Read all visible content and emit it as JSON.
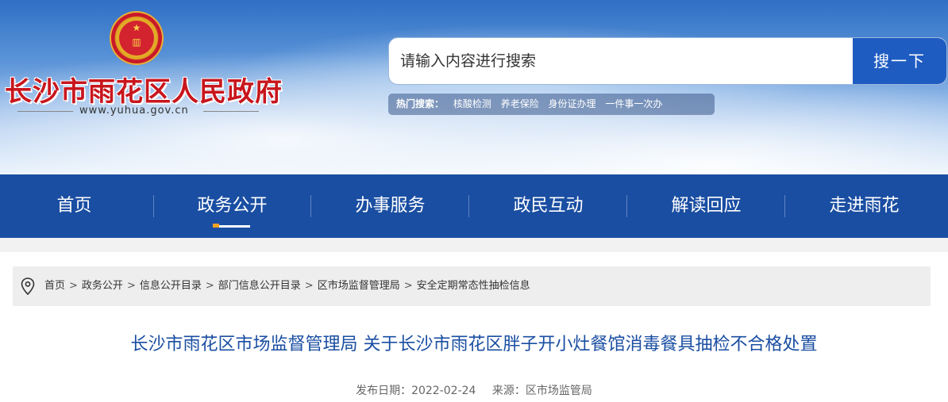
{
  "header": {
    "site_title": "长沙市雨花区人民政府",
    "site_domain": "www.yuhua.gov.cn"
  },
  "search": {
    "placeholder": "请输入内容进行搜索",
    "button_label": "搜一下",
    "hot_label": "热门搜索：",
    "hot_items": [
      "核酸检测",
      "养老保险",
      "身份证办理",
      "一件事一次办"
    ]
  },
  "nav": {
    "items": [
      "首页",
      "政务公开",
      "办事服务",
      "政民互动",
      "解读回应",
      "走进雨花"
    ],
    "active_index": 1
  },
  "breadcrumb": {
    "items": [
      "首页",
      "政务公开",
      "信息公开目录",
      "部门信息公开目录",
      "区市场监督管理局",
      "安全定期常态性抽检信息"
    ],
    "separator": ">"
  },
  "article": {
    "title": "长沙市雨花区市场监督管理局 关于长沙市雨花区胖子开小灶餐馆消毒餐具抽检不合格处置",
    "date_label": "发布日期：2022-02-24",
    "source_label": "来源：区市场监管局"
  },
  "colors": {
    "nav_bg": "#1a4ea2",
    "title_red": "#c8161d",
    "search_button": "#1e5cc2"
  }
}
